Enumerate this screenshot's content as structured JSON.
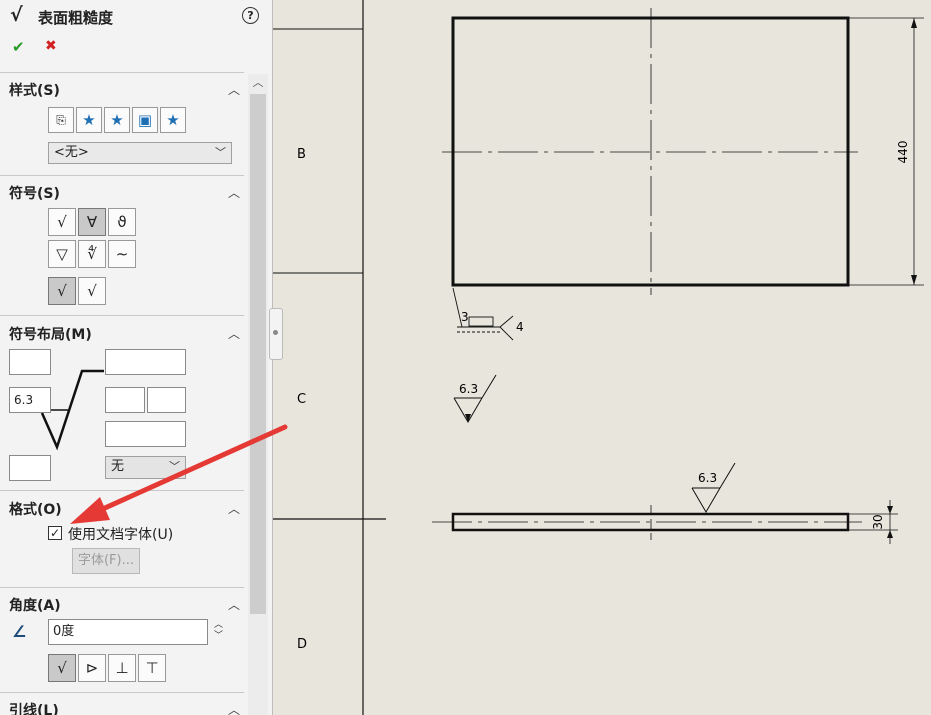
{
  "panel": {
    "title": "表面粗糙度",
    "title_icon": "√",
    "help_icon": "?",
    "ok_icon": "✔",
    "cancel_icon": "✖",
    "sections": {
      "style": {
        "title": "样式(S)",
        "dropdown_value": "<无>"
      },
      "symbol": {
        "title": "符号(S)"
      },
      "layout": {
        "title": "符号布局(M)",
        "roughness_value": "6.3",
        "direction_value": "无"
      },
      "format": {
        "title": "格式(O)",
        "use_doc_font_label": "使用文档字体(U)",
        "use_doc_font_checked": true,
        "font_button": "字体(F)..."
      },
      "angle": {
        "title": "角度(A)",
        "angle_value": "0度"
      },
      "leader": {
        "title": "引线(L)"
      }
    }
  },
  "drawing": {
    "zone_labels": [
      "B",
      "C",
      "D"
    ],
    "dim_440": "440",
    "dim_30": "30",
    "roughness_label_1": "6.3",
    "roughness_label_2": "6.3",
    "weld_num_left": "3",
    "weld_num_right": "4"
  },
  "colors": {
    "canvas": "#e8e6dc",
    "arrow": "#e53935",
    "ok": "#2a9a2a",
    "cancel": "#d02020"
  }
}
